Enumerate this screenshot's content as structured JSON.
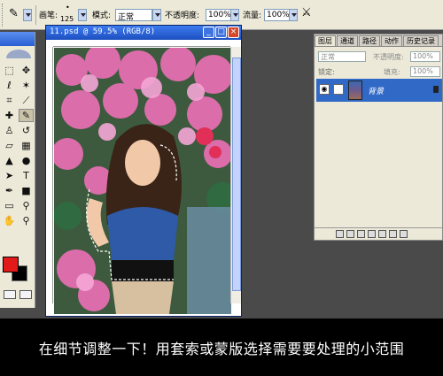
{
  "options_bar": {
    "brush_label": "画笔:",
    "brush_size": "125",
    "mode_label": "模式:",
    "mode_value": "正常",
    "opacity_label": "不透明度:",
    "opacity_value": "100%",
    "flow_label": "流量:",
    "flow_value": "100%"
  },
  "document": {
    "title": "11.psd @ 59.5% (RGB/8)",
    "controls": [
      "_",
      "□",
      "×"
    ]
  },
  "layers_panel": {
    "tabs": [
      "图层",
      "通道",
      "路径",
      "动作",
      "历史记录"
    ],
    "blend_mode": "正常",
    "opacity_label": "不透明度:",
    "opacity_value": "100%",
    "lock_label": "锁定:",
    "fill_label": "填充:",
    "fill_value": "100%",
    "layer_name": "背景"
  },
  "colors": {
    "foreground": "#e31a1a",
    "background": "#000000",
    "selection": "#3169c6"
  },
  "caption": "在细节调整一下！用套索或蒙版选择需要要处理的小范围"
}
